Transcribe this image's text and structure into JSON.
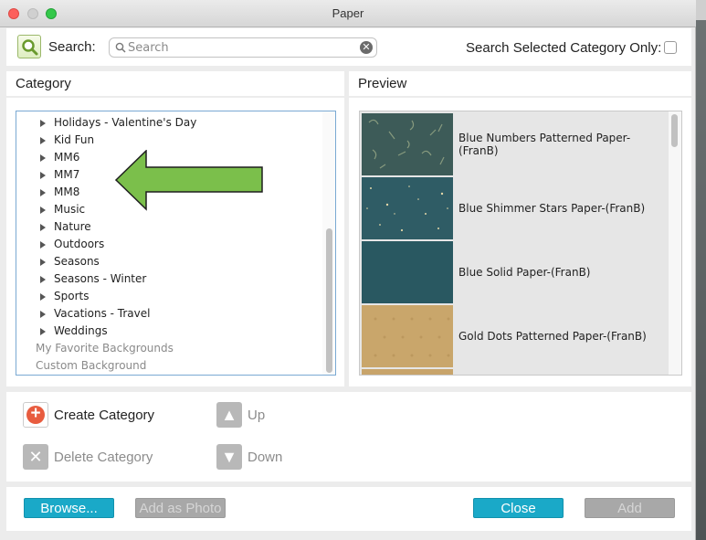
{
  "window": {
    "title": "Paper"
  },
  "search": {
    "label": "Search:",
    "placeholder": "Search",
    "value": "",
    "selected_only_label": "Search Selected Category Only:"
  },
  "category": {
    "header": "Category",
    "items": [
      {
        "label": "Holidays - Valentine's Day",
        "expandable": true
      },
      {
        "label": "Kid Fun",
        "expandable": true
      },
      {
        "label": "MM6",
        "expandable": true
      },
      {
        "label": "MM7",
        "expandable": true
      },
      {
        "label": "MM8",
        "expandable": true
      },
      {
        "label": "Music",
        "expandable": true
      },
      {
        "label": "Nature",
        "expandable": true
      },
      {
        "label": "Outdoors",
        "expandable": true
      },
      {
        "label": "Seasons",
        "expandable": true
      },
      {
        "label": "Seasons - Winter",
        "expandable": true
      },
      {
        "label": "Sports",
        "expandable": true
      },
      {
        "label": "Vacations - Travel",
        "expandable": true
      },
      {
        "label": "Weddings",
        "expandable": true
      },
      {
        "label": "My Favorite Backgrounds",
        "expandable": false
      },
      {
        "label": "Custom Background",
        "expandable": false
      }
    ]
  },
  "preview": {
    "header": "Preview",
    "items": [
      {
        "label": "Blue Numbers Patterned Paper-(FranB)",
        "color": "#3d5b58"
      },
      {
        "label": "Blue Shimmer Stars Paper-(FranB)",
        "color": "#2f5c65"
      },
      {
        "label": "Blue Solid Paper-(FranB)",
        "color": "#2c5c66"
      },
      {
        "label": "Gold Dots Patterned Paper-(FranB)",
        "color": "#c9a66b"
      }
    ]
  },
  "actions": {
    "create_category": "Create Category",
    "delete_category": "Delete Category",
    "up": "Up",
    "down": "Down"
  },
  "footer": {
    "browse": "Browse...",
    "add_as_photo": "Add as Photo",
    "close": "Close",
    "add": "Add"
  },
  "colors": {
    "accent": "#1aa9c8",
    "arrow": "#7bbf4b",
    "create_icon": "#e85c3f"
  }
}
